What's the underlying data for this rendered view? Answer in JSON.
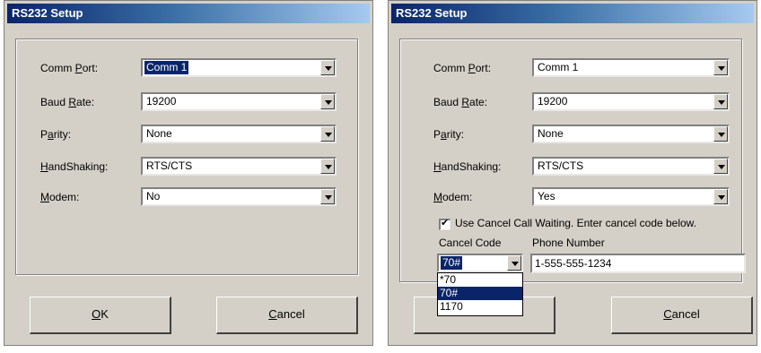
{
  "left_dialog": {
    "title": "RS232 Setup",
    "comm_port": {
      "label_pre": "Comm ",
      "label_acc": "P",
      "label_post": "ort:",
      "value": "Comm 1"
    },
    "baud_rate": {
      "label_pre": "Baud ",
      "label_acc": "R",
      "label_post": "ate:",
      "value": "19200"
    },
    "parity": {
      "label_pre": "P",
      "label_acc": "a",
      "label_post": "rity:",
      "value": "None"
    },
    "handshaking": {
      "label_pre": "",
      "label_acc": "H",
      "label_post": "andShaking:",
      "value": "RTS/CTS"
    },
    "modem": {
      "label_pre": "",
      "label_acc": "M",
      "label_post": "odem:",
      "value": "No"
    },
    "ok_button": {
      "acc": "O",
      "rest": "K"
    },
    "cancel_button": {
      "acc": "C",
      "rest": "ancel"
    }
  },
  "right_dialog": {
    "title": "RS232 Setup",
    "comm_port": {
      "label_pre": "Comm ",
      "label_acc": "P",
      "label_post": "ort:",
      "value": "Comm 1"
    },
    "baud_rate": {
      "label_pre": "Baud ",
      "label_acc": "R",
      "label_post": "ate:",
      "value": "19200"
    },
    "parity": {
      "label_pre": "P",
      "label_acc": "a",
      "label_post": "rity:",
      "value": "None"
    },
    "handshaking": {
      "label_pre": "",
      "label_acc": "H",
      "label_post": "andShaking:",
      "value": "RTS/CTS"
    },
    "modem": {
      "label_pre": "",
      "label_acc": "M",
      "label_post": "odem:",
      "value": "Yes"
    },
    "cancel_call_waiting": {
      "checked": true,
      "label": "Use Cancel Call Waiting. Enter cancel code below."
    },
    "cancel_code": {
      "label": "Cancel Code",
      "value": "70#",
      "options": [
        "*70",
        "70#",
        "1170"
      ],
      "highlighted": "70#"
    },
    "phone_number": {
      "label": "Phone Number",
      "value": "1-555-555-1234"
    },
    "cancel_button": {
      "acc": "C",
      "rest": "ancel"
    }
  }
}
